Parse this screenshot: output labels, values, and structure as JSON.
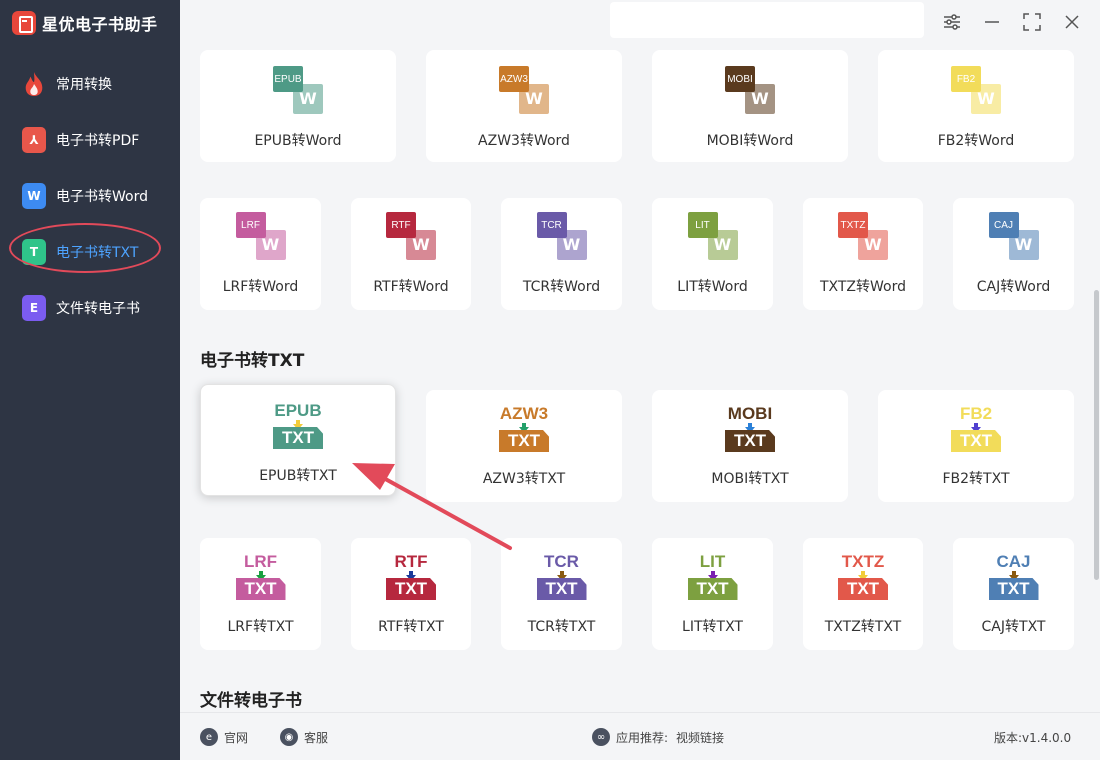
{
  "app": {
    "title": "星优电子书助手"
  },
  "sidebar": {
    "items": [
      {
        "label": "常用转换",
        "icon": "flame-icon",
        "color": "#e8473b",
        "glyph": ""
      },
      {
        "label": "电子书转PDF",
        "icon": "pdf-icon",
        "color": "#e8574b",
        "glyph": "⅄"
      },
      {
        "label": "电子书转Word",
        "icon": "word-icon",
        "color": "#3d8bf2",
        "glyph": "W"
      },
      {
        "label": "电子书转TXT",
        "icon": "txt-icon",
        "color": "#2fc48a",
        "glyph": "T",
        "active": true
      },
      {
        "label": "文件转电子书",
        "icon": "ebook-icon",
        "color": "#7b5cf0",
        "glyph": "E"
      }
    ]
  },
  "word_row1": [
    {
      "fmt": "EPUB",
      "label": "EPUB转Word",
      "color": "#4e9a86"
    },
    {
      "fmt": "AZW3",
      "label": "AZW3转Word",
      "color": "#c87a2a"
    },
    {
      "fmt": "MOBI",
      "label": "MOBI转Word",
      "color": "#5a3a1e"
    },
    {
      "fmt": "FB2",
      "label": "FB2转Word",
      "color": "#f2dc5a"
    }
  ],
  "word_row2": [
    {
      "fmt": "LRF",
      "label": "LRF转Word",
      "color": "#c45c9e"
    },
    {
      "fmt": "RTF",
      "label": "RTF转Word",
      "color": "#b6283e"
    },
    {
      "fmt": "TCR",
      "label": "TCR转Word",
      "color": "#6a5aa8"
    },
    {
      "fmt": "LIT",
      "label": "LIT转Word",
      "color": "#7da040"
    },
    {
      "fmt": "TXTZ",
      "label": "TXTZ转Word",
      "color": "#e2584a"
    },
    {
      "fmt": "CAJ",
      "label": "CAJ转Word",
      "color": "#4f7fb4"
    }
  ],
  "sections": {
    "txt": "电子书转TXT",
    "ebook": "文件转电子书"
  },
  "txt_row1": [
    {
      "fmt": "EPUB",
      "label": "EPUB转TXT",
      "color": "#4e9a86",
      "arrow": "#f2cc3a",
      "selected": true
    },
    {
      "fmt": "AZW3",
      "label": "AZW3转TXT",
      "color": "#c87a2a",
      "arrow": "#23a06a"
    },
    {
      "fmt": "MOBI",
      "label": "MOBI转TXT",
      "color": "#5a3a1e",
      "arrow": "#2a80d8"
    },
    {
      "fmt": "FB2",
      "label": "FB2转TXT",
      "color": "#f2dc5a",
      "arrow": "#5040d0"
    }
  ],
  "txt_row2": [
    {
      "fmt": "LRF",
      "label": "LRF转TXT",
      "color": "#c45c9e",
      "arrow": "#18a040"
    },
    {
      "fmt": "RTF",
      "label": "RTF转TXT",
      "color": "#b6283e",
      "arrow": "#1a3a9a"
    },
    {
      "fmt": "TCR",
      "label": "TCR转TXT",
      "color": "#6a5aa8",
      "arrow": "#8a5a10"
    },
    {
      "fmt": "LIT",
      "label": "LIT转TXT",
      "color": "#7da040",
      "arrow": "#7a20b0"
    },
    {
      "fmt": "TXTZ",
      "label": "TXTZ转TXT",
      "color": "#e2584a",
      "arrow": "#f2cc3a"
    },
    {
      "fmt": "CAJ",
      "label": "CAJ转TXT",
      "color": "#4f7fb4",
      "arrow": "#8a5a10"
    }
  ],
  "txt_glyph": "TXT",
  "word_glyph": "W",
  "footer": {
    "website": "官网",
    "support": "客服",
    "recommend_label": "应用推荐:",
    "recommend_link": "视频链接",
    "version": "版本:v1.4.0.0"
  },
  "colors": {
    "sidebar_bg": "#2e3544",
    "accent": "#4da3ff",
    "annotation": "#e24a5a"
  }
}
